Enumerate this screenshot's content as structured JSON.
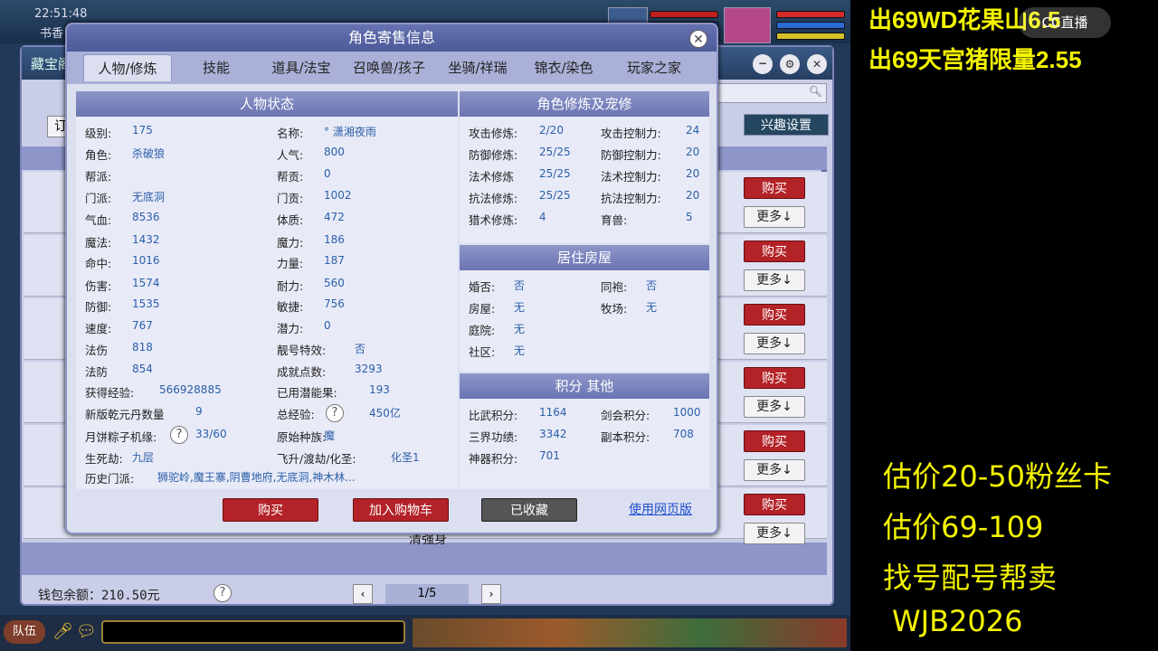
{
  "game": {
    "top": {
      "time": "22:51:48",
      "location": "书香"
    },
    "bg_window": {
      "title": "藏宝阁",
      "side_tab": "订",
      "interest_btn": "兴趣设置",
      "buy_label": "购买",
      "more_label": "更多↓",
      "row_snippet": "清强身",
      "wallet": "钱包余额：210.50元",
      "page": "1/5"
    },
    "bottom": {
      "team": "队伍"
    }
  },
  "dialog": {
    "title": "角色寄售信息",
    "tabs": [
      "人物/修炼",
      "技能",
      "道具/法宝",
      "召唤兽/孩子",
      "坐骑/祥瑞",
      "锦衣/染色",
      "玩家之家"
    ],
    "status_title": "人物状态",
    "status": {
      "left": [
        {
          "l": "级别:",
          "v": "175"
        },
        {
          "l": "角色:",
          "v": "杀破狼"
        },
        {
          "l": "帮派:",
          "v": ""
        },
        {
          "l": "门派:",
          "v": "无底洞"
        },
        {
          "l": "气血:",
          "v": "8536"
        },
        {
          "l": "魔法:",
          "v": "1432"
        },
        {
          "l": "命中:",
          "v": "1016"
        },
        {
          "l": "伤害:",
          "v": "1574"
        },
        {
          "l": "防御:",
          "v": "1535"
        },
        {
          "l": "速度:",
          "v": "767"
        },
        {
          "l": "法伤",
          "v": "818"
        },
        {
          "l": "法防",
          "v": "854"
        },
        {
          "l": "获得经验:",
          "v": "566928885"
        },
        {
          "l": "新版乾元丹数量",
          "v": "9"
        },
        {
          "l": "月饼粽子机缘:",
          "v": "33/60"
        },
        {
          "l": "生死劫:",
          "v": "九层"
        },
        {
          "l": "历史门派:",
          "v": "狮驼岭,魔王寨,阴曹地府,无底洞,神木林..."
        }
      ],
      "right": [
        {
          "l": "名称:",
          "v": "° 潇湘夜雨"
        },
        {
          "l": "人气:",
          "v": "800"
        },
        {
          "l": "帮贡:",
          "v": "0"
        },
        {
          "l": "门贡:",
          "v": "1002"
        },
        {
          "l": "体质:",
          "v": "472"
        },
        {
          "l": "魔力:",
          "v": "186"
        },
        {
          "l": "力量:",
          "v": "187"
        },
        {
          "l": "耐力:",
          "v": "560"
        },
        {
          "l": "敏捷:",
          "v": "756"
        },
        {
          "l": "潜力:",
          "v": "0"
        },
        {
          "l": "靓号特效:",
          "v": "否"
        },
        {
          "l": "成就点数:",
          "v": "3293"
        },
        {
          "l": "已用潜能果:",
          "v": "193"
        },
        {
          "l": "总经验:",
          "v": "450亿"
        },
        {
          "l": "原始种族:",
          "v": "魔"
        },
        {
          "l": "飞升/渡劫/化圣:",
          "v": "化圣1"
        }
      ]
    },
    "cultivation_title": "角色修炼及宠修",
    "cultivation": [
      {
        "l1": "攻击修炼:",
        "v1": "2/20",
        "l2": "攻击控制力:",
        "v2": "24"
      },
      {
        "l1": "防御修炼:",
        "v1": "25/25",
        "l2": "防御控制力:",
        "v2": "20"
      },
      {
        "l1": "法术修炼",
        "v1": "25/25",
        "l2": "法术控制力:",
        "v2": "20"
      },
      {
        "l1": "抗法修炼:",
        "v1": "25/25",
        "l2": "抗法控制力:",
        "v2": "20"
      },
      {
        "l1": "猎术修炼:",
        "v1": "4",
        "l2": "育兽:",
        "v2": "5"
      }
    ],
    "house_title": "居住房屋",
    "house": [
      {
        "l1": "婚否:",
        "v1": "否",
        "l2": "同袍:",
        "v2": "否"
      },
      {
        "l1": "房屋:",
        "v1": "无",
        "l2": "牧场:",
        "v2": "无"
      },
      {
        "l1": "庭院:",
        "v1": "无",
        "l2": "",
        "v2": ""
      },
      {
        "l1": "社区:",
        "v1": "无",
        "l2": "",
        "v2": ""
      }
    ],
    "points_title": "积分 其他",
    "points": [
      {
        "l1": "比武积分:",
        "v1": "1164",
        "l2": "剑会积分:",
        "v2": "1000"
      },
      {
        "l1": "三界功绩:",
        "v1": "3342",
        "l2": "副本积分:",
        "v2": "708"
      },
      {
        "l1": "神器积分:",
        "v1": "701",
        "l2": "",
        "v2": ""
      }
    ],
    "buttons": {
      "buy": "购买",
      "cart": "加入购物车",
      "fav": "已收藏",
      "web": "使用网页版"
    }
  },
  "overlay": {
    "line1": "出69WD花果山6.5",
    "line2": "出69天宫猪限量2.55",
    "logo": "CC直播",
    "est1": "估价20-50粉丝卡",
    "est2": "估价69-109",
    "service": "找号配号帮卖",
    "wechat": "WJB2026"
  }
}
